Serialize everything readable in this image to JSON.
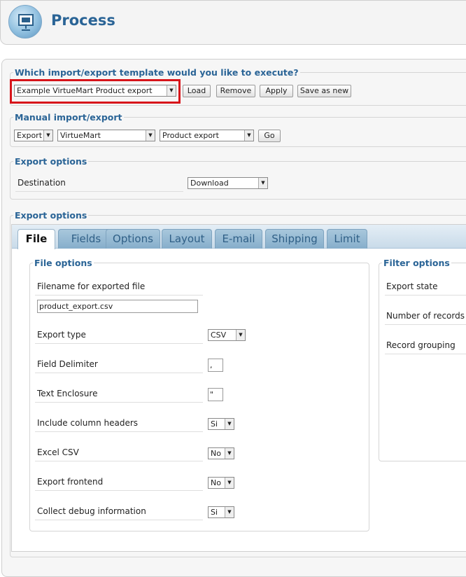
{
  "page": {
    "title": "Process"
  },
  "template_section": {
    "legend": "Which import/export template would you like to execute?",
    "selected_template": "Example VirtueMart Product export",
    "buttons": {
      "load": "Load",
      "remove": "Remove",
      "apply": "Apply",
      "save_as_new": "Save as new"
    }
  },
  "manual_section": {
    "legend": "Manual import/export",
    "action": "Export",
    "component": "VirtueMart",
    "operation": "Product export",
    "go": "Go"
  },
  "export_options_1": {
    "legend": "Export options",
    "destination_label": "Destination",
    "destination_value": "Download"
  },
  "export_options_2": {
    "legend": "Export options"
  },
  "tabs": [
    "File",
    "Fields",
    "Options",
    "Layout",
    "E-mail",
    "Shipping",
    "Limit"
  ],
  "active_tab": "File",
  "file_options": {
    "legend": "File options",
    "filename_label": "Filename for exported file",
    "filename_value": "product_export.csv",
    "export_type_label": "Export type",
    "export_type_value": "CSV",
    "field_delimiter_label": "Field Delimiter",
    "field_delimiter_value": ",",
    "text_enclosure_label": "Text Enclosure",
    "text_enclosure_value": "\"",
    "include_headers_label": "Include column headers",
    "include_headers_value": "Si",
    "excel_csv_label": "Excel CSV",
    "excel_csv_value": "No",
    "export_frontend_label": "Export frontend",
    "export_frontend_value": "No",
    "debug_label": "Collect debug information",
    "debug_value": "Si"
  },
  "filter_options": {
    "legend": "Filter options",
    "export_state": "Export state",
    "number_of_records": "Number of records",
    "record_grouping": "Record grouping"
  },
  "icons": {
    "logo": "process-icon",
    "dropdown": "dropdown-arrow-icon"
  }
}
